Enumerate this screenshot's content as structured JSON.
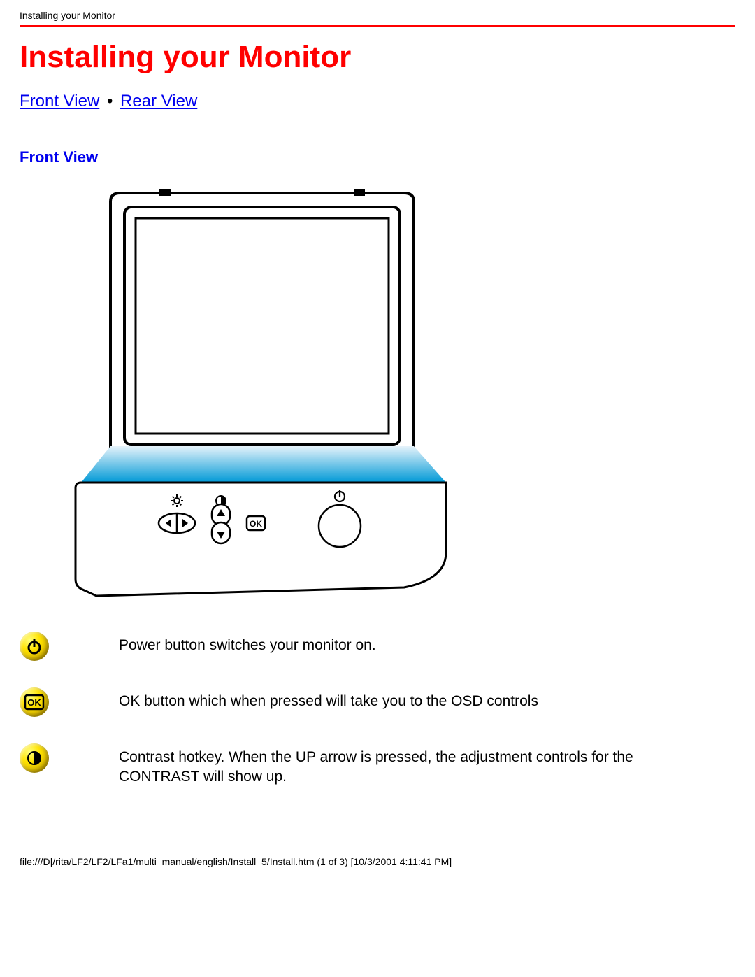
{
  "header": {
    "running_title": "Installing your Monitor"
  },
  "title": "Installing your Monitor",
  "nav": {
    "front_view": "Front View",
    "separator": "•",
    "rear_view": "Rear View"
  },
  "sections": {
    "front_view_heading": "Front View"
  },
  "legend": {
    "power": "Power button switches your monitor on.",
    "ok": "OK button which when pressed will take you to the OSD controls",
    "contrast": "Contrast hotkey. When the UP arrow is pressed, the adjustment controls for the CONTRAST will show up."
  },
  "footer": {
    "path_line": "file:///D|/rita/LF2/LF2/LFa1/multi_manual/english/Install_5/Install.htm (1 of 3) [10/3/2001 4:11:41 PM]"
  }
}
